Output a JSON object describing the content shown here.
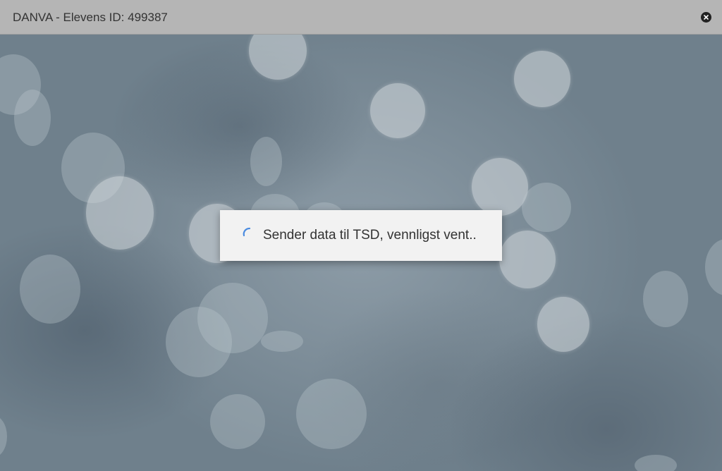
{
  "window": {
    "title": "DANVA - Elevens ID: 499387",
    "close_icon": "close-icon"
  },
  "dialog": {
    "message": "Sender data til TSD, vennligst vent..",
    "spinner_icon": "loading-spinner-icon",
    "spinner_color": "#4a8be0"
  },
  "colors": {
    "titlebar": "#b5b5b5",
    "background": "#7d8d98",
    "dialog": "#f2f2f2"
  }
}
